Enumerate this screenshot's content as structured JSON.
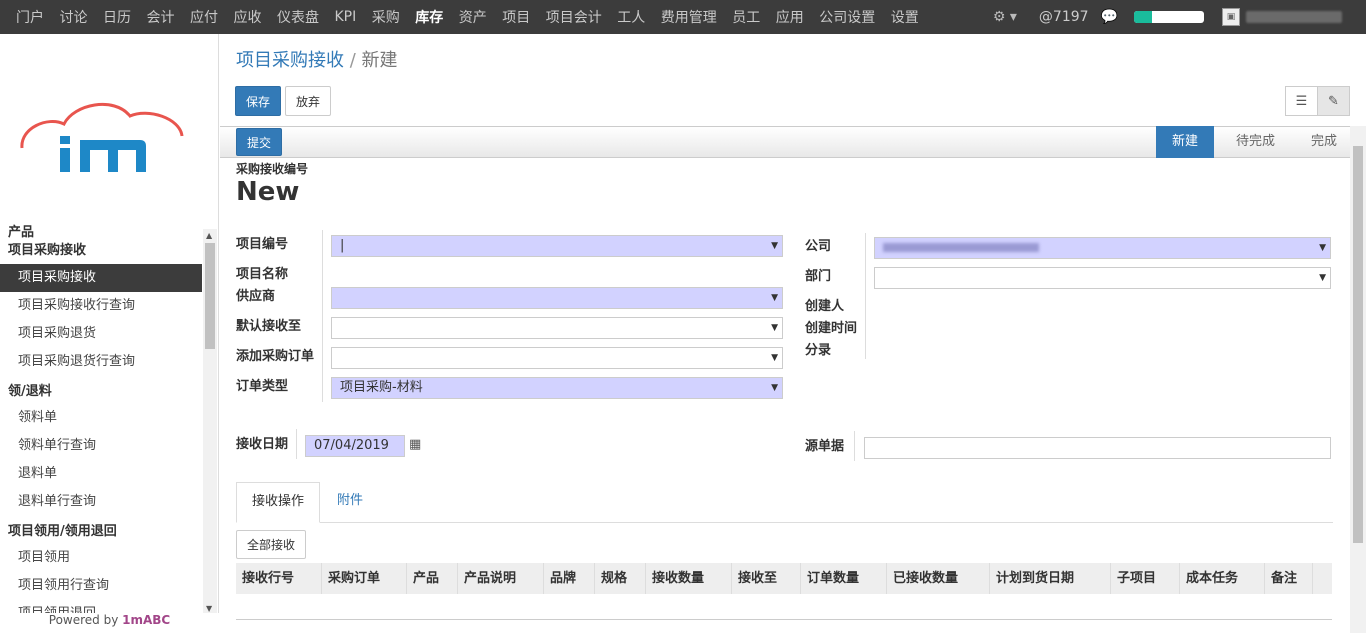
{
  "topnav": {
    "items": [
      "门户",
      "讨论",
      "日历",
      "会计",
      "应付",
      "应收",
      "仪表盘",
      "KPI",
      "采购",
      "库存",
      "资产",
      "项目",
      "项目会计",
      "工人",
      "费用管理",
      "员工",
      "应用",
      "公司设置",
      "设置"
    ],
    "active_index": 9,
    "notif": "@7197",
    "progress_fraction": 0.25
  },
  "sidebar": {
    "sections": [
      {
        "title": "产品",
        "items": []
      },
      {
        "title": "项目采购接收",
        "items": [
          "项目采购接收",
          "项目采购接收行查询",
          "项目采购退货",
          "项目采购退货行查询"
        ]
      },
      {
        "title": "领/退料",
        "items": [
          "领料单",
          "领料单行查询",
          "退料单",
          "退料单行查询"
        ]
      },
      {
        "title": "项目领用/领用退回",
        "items": [
          "项目领用",
          "项目领用行查询",
          "项目领用退回"
        ]
      }
    ],
    "active_item": "项目采购接收",
    "powered_prefix": "Powered by ",
    "powered_brand": "1mABC"
  },
  "breadcrumb": {
    "parent": "项目采购接收",
    "sep": "/",
    "current": "新建"
  },
  "buttons": {
    "save": "保存",
    "discard": "放弃",
    "submit": "提交",
    "receive_all": "全部接收"
  },
  "stages": [
    "新建",
    "待完成",
    "完成"
  ],
  "form": {
    "number_label": "采购接收编号",
    "number_value": "New",
    "left_labels": [
      "项目编号",
      "项目名称",
      "供应商",
      "默认接收至",
      "添加采购订单",
      "订单类型"
    ],
    "order_type_value": "项目采购-材料",
    "right_labels": [
      "公司",
      "部门",
      "创建人",
      "创建时间",
      "分录"
    ],
    "receive_date_label": "接收日期",
    "receive_date_value": "07/04/2019",
    "source_label": "源单据"
  },
  "tabs": [
    "接收操作",
    "附件"
  ],
  "table_headers": [
    "接收行号",
    "采购订单",
    "产品",
    "产品说明",
    "品牌",
    "规格",
    "接收数量",
    "接收至",
    "订单数量",
    "已接收数量",
    "计划到货日期",
    "子项目",
    "成本任务",
    "备注"
  ],
  "colors": {
    "primary": "#337ab7",
    "topbar": "#3c3c3c",
    "required": "#d2d2ff",
    "logo_blue": "#1e88c7",
    "logo_cloud": "#e8554e"
  }
}
